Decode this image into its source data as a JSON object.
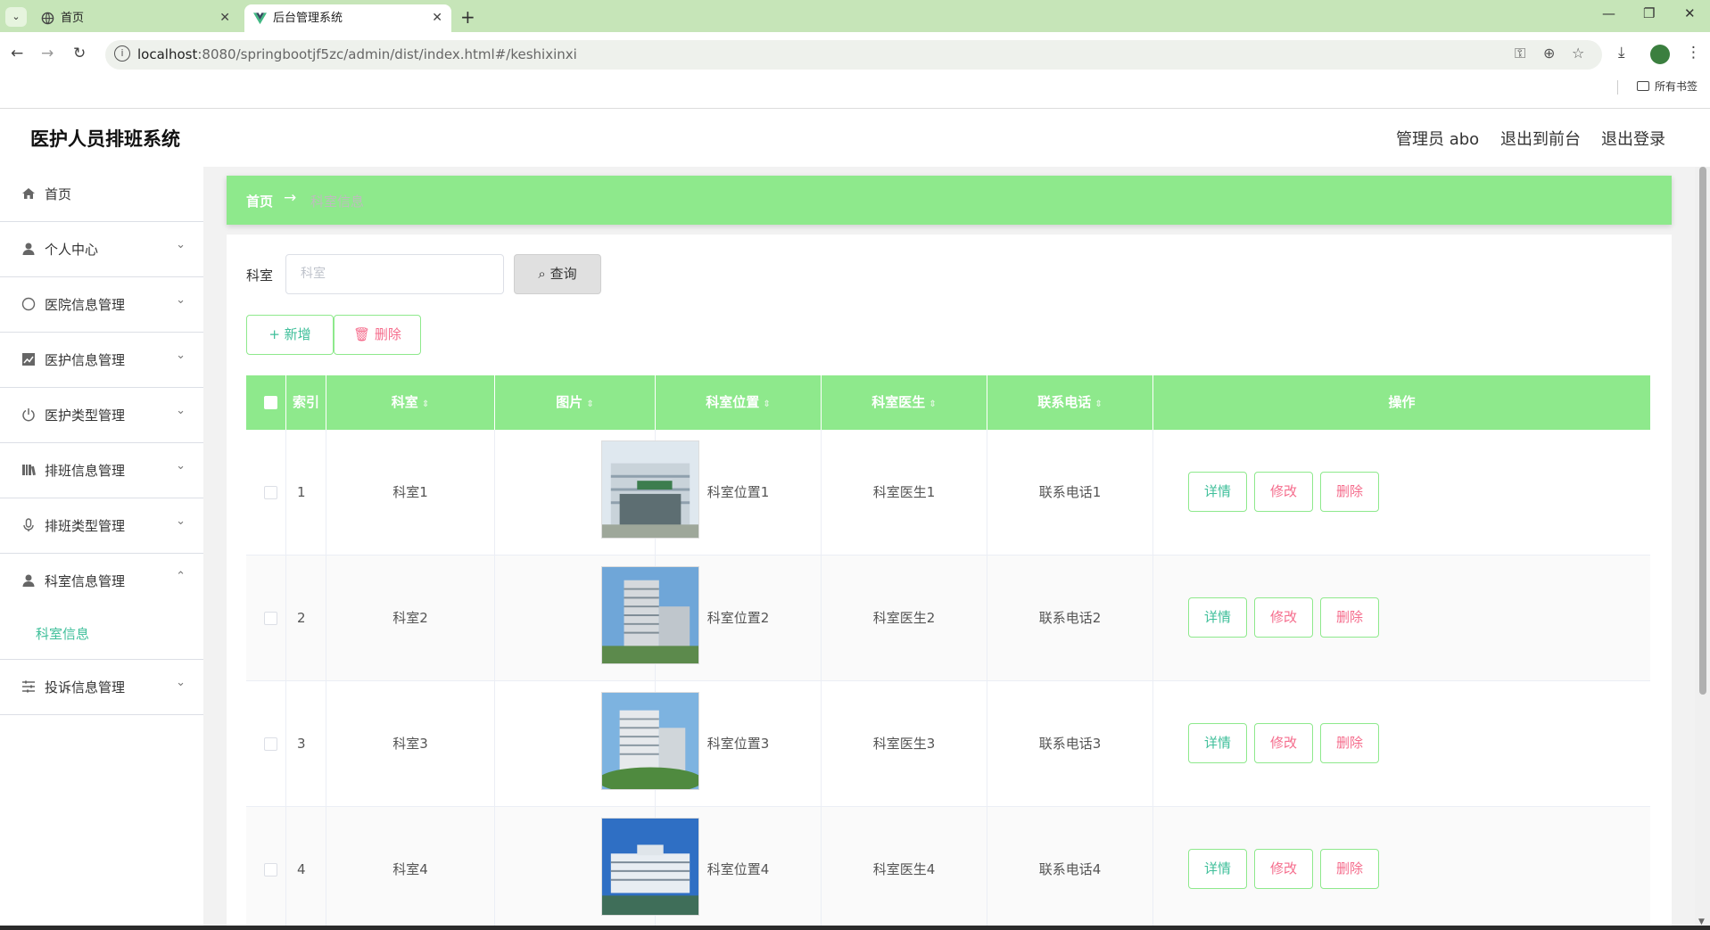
{
  "browser": {
    "tabs": [
      {
        "title": "首页",
        "icon": "globe-icon"
      },
      {
        "title": "后台管理系统",
        "icon": "vue-logo-icon"
      }
    ],
    "url_host": "localhost",
    "url_rest": ":8080/springbootjf5zc/admin/dist/index.html#/keshixinxi",
    "bookmarks_label": "所有书签"
  },
  "header": {
    "app_title": "医护人员排班系统",
    "user_label": "管理员 abo",
    "exit_front": "退出到前台",
    "logout": "退出登录"
  },
  "sidebar": {
    "items": [
      {
        "label": "首页",
        "icon": "home-icon",
        "arrow": ""
      },
      {
        "label": "个人中心",
        "icon": "user-icon",
        "arrow": "⌄"
      },
      {
        "label": "医院信息管理",
        "icon": "compass-icon",
        "arrow": "⌄"
      },
      {
        "label": "医护信息管理",
        "icon": "chart-icon",
        "arrow": "⌄"
      },
      {
        "label": "医护类型管理",
        "icon": "power-icon",
        "arrow": "⌄"
      },
      {
        "label": "排班信息管理",
        "icon": "bars-icon",
        "arrow": "⌄"
      },
      {
        "label": "排班类型管理",
        "icon": "microphone-icon",
        "arrow": "⌄"
      },
      {
        "label": "科室信息管理",
        "icon": "user-icon",
        "arrow": "⌃"
      },
      {
        "label": "投诉信息管理",
        "icon": "sliders-icon",
        "arrow": "⌄"
      }
    ],
    "submenu": {
      "label": "科室信息"
    }
  },
  "breadcrumb": {
    "home": "首页",
    "separator": "→",
    "current": "科室信息"
  },
  "search": {
    "label": "科室",
    "placeholder": "科室",
    "button": "查询"
  },
  "actions": {
    "add": "新增",
    "delete": "删除"
  },
  "table": {
    "headers": [
      "索引",
      "科室",
      "图片",
      "科室位置",
      "科室医生",
      "联系电话",
      "操作"
    ],
    "rows": [
      {
        "index": "1",
        "name": "科室1",
        "location": "科室位置1",
        "doctor": "科室医生1",
        "phone": "联系电话1"
      },
      {
        "index": "2",
        "name": "科室2",
        "location": "科室位置2",
        "doctor": "科室医生2",
        "phone": "联系电话2"
      },
      {
        "index": "3",
        "name": "科室3",
        "location": "科室位置3",
        "doctor": "科室医生3",
        "phone": "联系电话3"
      },
      {
        "index": "4",
        "name": "科室4",
        "location": "科室位置4",
        "doctor": "科室医生4",
        "phone": "联系电话4"
      }
    ],
    "row_actions": {
      "detail": "详情",
      "edit": "修改",
      "remove": "删除"
    }
  },
  "colors": {
    "accent": "#8ee98c",
    "primary_text": "#3fbf9a",
    "danger": "#f56c8c"
  }
}
